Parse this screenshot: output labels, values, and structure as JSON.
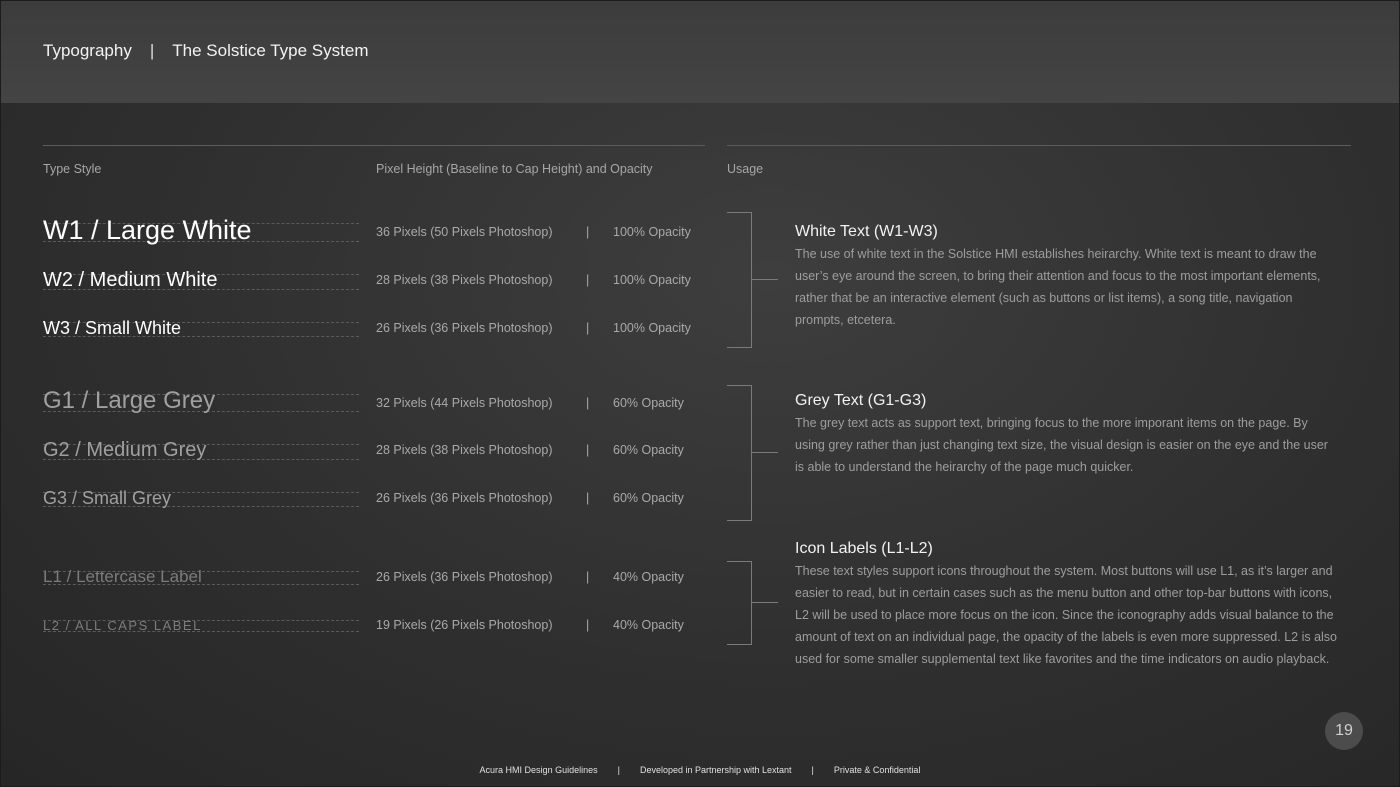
{
  "header": {
    "section": "Typography",
    "separator": "|",
    "title": "The Solstice Type System"
  },
  "columns": {
    "type_style": "Type Style",
    "pixel_height": "Pixel Height (Baseline to Cap Height) and Opacity",
    "usage": "Usage"
  },
  "styles": [
    {
      "name": "W1 / Large White",
      "spec": "36 Pixels (50 Pixels Photoshop)",
      "sep": "|",
      "opacity": "100% Opacity",
      "color": "#ffffff"
    },
    {
      "name": "W2 / Medium White",
      "spec": "28 Pixels (38 Pixels Photoshop)",
      "sep": "|",
      "opacity": "100% Opacity",
      "color": "#ffffff"
    },
    {
      "name": "W3 / Small White",
      "spec": "26 Pixels (36 Pixels Photoshop)",
      "sep": "|",
      "opacity": "100% Opacity",
      "color": "#ffffff"
    },
    {
      "name": "G1 / Large Grey",
      "spec": "32 Pixels (44 Pixels Photoshop)",
      "sep": "|",
      "opacity": "60% Opacity",
      "color": "#a0a0a0"
    },
    {
      "name": "G2 / Medium Grey",
      "spec": "28 Pixels (38 Pixels Photoshop)",
      "sep": "|",
      "opacity": "60% Opacity",
      "color": "#a0a0a0"
    },
    {
      "name": "G3 / Small Grey",
      "spec": "26 Pixels (36 Pixels Photoshop)",
      "sep": "|",
      "opacity": "60% Opacity",
      "color": "#a0a0a0"
    },
    {
      "name": "L1 / Lettercase Label",
      "spec": "26 Pixels (36 Pixels Photoshop)",
      "sep": "|",
      "opacity": "40% Opacity",
      "color": "#7c7c7c"
    },
    {
      "name": "L2 / ALL CAPS LABEL",
      "spec": "19 Pixels (26 Pixels Photoshop)",
      "sep": "|",
      "opacity": "40% Opacity",
      "color": "#7c7c7c"
    }
  ],
  "usage": [
    {
      "title": "White Text (W1-W3)",
      "body": "The use of white text in the Solstice HMI establishes heirarchy. White text is meant to draw the user’s eye around the screen, to bring their attention and focus to the most important elements, rather that be an interactive element (such as buttons or list items), a song title, navigation prompts, etcetera."
    },
    {
      "title": "Grey Text (G1-G3)",
      "body": "The grey text acts as support text, bringing focus to the more imporant items on the page. By using grey rather than just changing text size, the visual design is easier on the eye and the user is able to understand the heirarchy of the page much quicker."
    },
    {
      "title": "Icon Labels (L1-L2)",
      "body": "These text styles support icons throughout the system. Most buttons will use L1, as it’s larger and easier to read, but in certain cases such as the menu button and other top-bar buttons with icons, L2 will be used to place more focus on the icon. Since the iconography adds visual balance to the amount of text on an individual page, the opacity of the labels is even more suppressed. L2 is also used for some smaller supplemental text like favorites and the time indicators on audio playback."
    }
  ],
  "page_number": "19",
  "footer": {
    "left": "Acura HMI Design Guidelines",
    "middle": "Developed in Partnership with Lextant",
    "right": "Private & Confidential",
    "separator": "|"
  }
}
